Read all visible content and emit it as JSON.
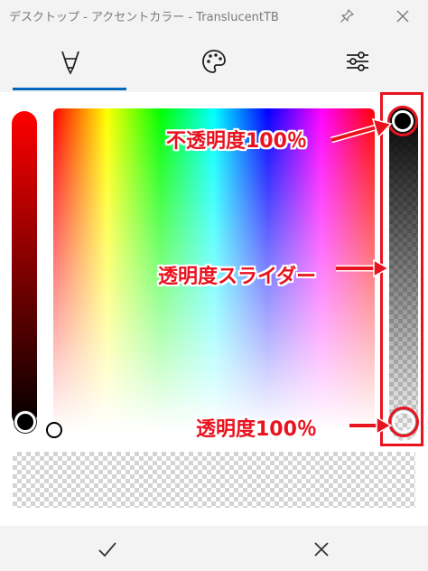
{
  "window": {
    "title": "デスクトップ - アクセントカラー - TranslucentTB",
    "icons": {
      "pin": "pin-icon",
      "close": "close-icon"
    }
  },
  "tabs": [
    {
      "icon": "brush-icon",
      "selected": true
    },
    {
      "icon": "palette-icon",
      "selected": false
    },
    {
      "icon": "sliders-icon",
      "selected": false
    }
  ],
  "colors": {
    "accent": "#0067c0",
    "annotation": "#e8131f",
    "selected_color": "#000000"
  },
  "picker": {
    "hue": "#ff0000",
    "opacity_top_percent": 100,
    "opacity_bottom_percent": 0
  },
  "annotations": {
    "opaque_label": "不透明度100％",
    "slider_label": "透明度スライダー",
    "transparent_label": "透明度100％"
  },
  "footer": {
    "confirm_icon": "checkmark-icon",
    "cancel_icon": "close-icon"
  }
}
